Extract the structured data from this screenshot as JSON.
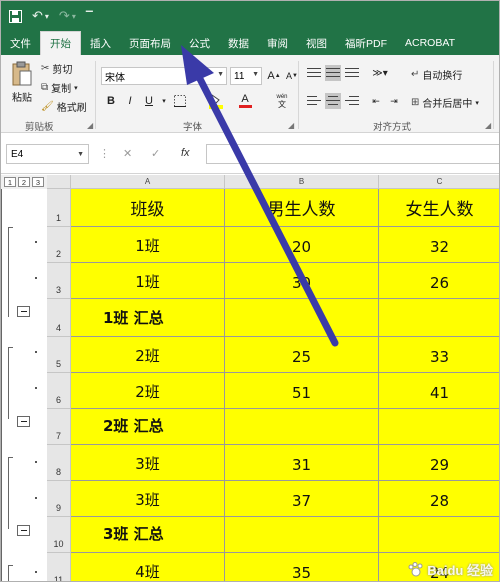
{
  "titlebar": {
    "save_icon": "save-icon",
    "undo_icon": "undo-icon",
    "redo_icon": "redo-icon"
  },
  "tabs": [
    "文件",
    "开始",
    "插入",
    "页面布局",
    "公式",
    "数据",
    "审阅",
    "视图",
    "福昕PDF",
    "ACROBAT"
  ],
  "active_tab": "开始",
  "ribbon": {
    "paste": "粘贴",
    "cut": "剪切",
    "copy": "复制",
    "format_painter": "格式刷",
    "clipboard_group": "剪贴板",
    "font_name": "宋体",
    "font_size": "11",
    "font_group": "字体",
    "bold": "B",
    "italic": "I",
    "underline": "U",
    "grow_font": "A",
    "shrink_font": "A",
    "wrap_text": "自动换行",
    "merge_center": "合并后居中",
    "align_group": "对齐方式",
    "wen": "wén",
    "font_color": "#e02020",
    "fill_color": "#ffff00"
  },
  "formula_bar": {
    "name_box": "E4",
    "cancel": "✕",
    "enter": "✓",
    "fx": "fx",
    "content": ""
  },
  "outline_levels": [
    "1",
    "2",
    "3"
  ],
  "columns": [
    "A",
    "B",
    "C"
  ],
  "rows": [
    {
      "num": "1",
      "a": "班级",
      "b": "男生人数",
      "c": "女生人数",
      "type": "header"
    },
    {
      "num": "2",
      "a": "1班",
      "b": "20",
      "c": "32",
      "type": "data"
    },
    {
      "num": "3",
      "a": "1班",
      "b": "30",
      "c": "26",
      "type": "data"
    },
    {
      "num": "4",
      "a": "1班 汇总",
      "b": "",
      "c": "",
      "type": "summary"
    },
    {
      "num": "5",
      "a": "2班",
      "b": "25",
      "c": "33",
      "type": "data"
    },
    {
      "num": "6",
      "a": "2班",
      "b": "51",
      "c": "41",
      "type": "data"
    },
    {
      "num": "7",
      "a": "2班 汇总",
      "b": "",
      "c": "",
      "type": "summary"
    },
    {
      "num": "8",
      "a": "3班",
      "b": "31",
      "c": "29",
      "type": "data"
    },
    {
      "num": "9",
      "a": "3班",
      "b": "37",
      "c": "28",
      "type": "data"
    },
    {
      "num": "10",
      "a": "3班 汇总",
      "b": "",
      "c": "",
      "type": "summary"
    },
    {
      "num": "11",
      "a": "4班",
      "b": "35",
      "c": "24",
      "type": "data"
    }
  ],
  "cell_fill": "#ffff00",
  "accent": "#217346",
  "annotation_arrow_color": "#3a3aa8",
  "watermark": "Baidu 经验"
}
